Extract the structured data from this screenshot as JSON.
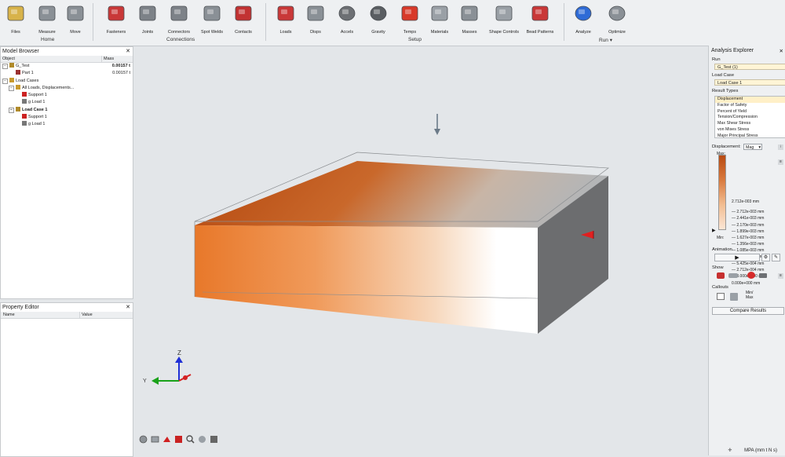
{
  "ribbon": {
    "tools": [
      {
        "label": "Files",
        "icon": "folder-icon"
      },
      {
        "label": "Measure",
        "icon": "measure-icon"
      },
      {
        "label": "Move",
        "icon": "move-icon"
      },
      {
        "label": "Fasteners",
        "icon": "fastener-icon"
      },
      {
        "label": "Joints",
        "icon": "joint-icon"
      },
      {
        "label": "Connectors",
        "icon": "connector-icon"
      },
      {
        "label": "Spot Welds",
        "icon": "spot-weld-icon"
      },
      {
        "label": "Contacts",
        "icon": "contact-icon"
      },
      {
        "label": "Loads",
        "icon": "load-icon"
      },
      {
        "label": "Disps",
        "icon": "displacement-icon"
      },
      {
        "label": "Accels",
        "icon": "acceleration-icon"
      },
      {
        "label": "Gravity",
        "icon": "gravity-icon"
      },
      {
        "label": "Temps",
        "icon": "temperature-icon"
      },
      {
        "label": "Materials",
        "icon": "material-icon"
      },
      {
        "label": "Masses",
        "icon": "mass-icon"
      },
      {
        "label": "Shape Controls",
        "icon": "shape-control-icon"
      },
      {
        "label": "Bead Patterns",
        "icon": "bead-pattern-icon"
      },
      {
        "label": "Analyze",
        "icon": "analyze-icon"
      },
      {
        "label": "Optimize",
        "icon": "optimize-icon"
      }
    ],
    "groups": {
      "home": "Home",
      "connections": "Connections",
      "setup": "Setup",
      "run": "Run"
    }
  },
  "model_browser": {
    "title": "Model Browser",
    "col_object": "Object",
    "col_mass": "Mass",
    "rows": [
      {
        "label": "G_Test",
        "mass": "0.00157 t"
      },
      {
        "label": "Part 1",
        "mass": "0.00157 t"
      },
      {
        "label": "Load Cases",
        "mass": ""
      },
      {
        "label": "All Loads, Displacements...",
        "mass": ""
      },
      {
        "label": "Support 1",
        "mass": ""
      },
      {
        "label": "g Load 1",
        "mass": ""
      },
      {
        "label": "Load Case 1",
        "mass": ""
      },
      {
        "label": "Support 1",
        "mass": ""
      },
      {
        "label": "g Load 1",
        "mass": ""
      }
    ]
  },
  "property_editor": {
    "title": "Property Editor",
    "col_name": "Name",
    "col_value": "Value"
  },
  "analysis_explorer": {
    "title": "Analysis Explorer",
    "run_label": "Run",
    "run_value": "G_Test (1)",
    "load_case_label": "Load Case",
    "load_case_value": "Load Case 1",
    "result_types_label": "Result Types",
    "result_types": [
      "Displacement",
      "Factor of Safety",
      "Percent of Yield",
      "Tension/Compression",
      "Max Shear Stress",
      "von Mises Stress",
      "Major Principal Stress"
    ],
    "selected_result": "Displacement",
    "displacement_label": "Displacement:",
    "component": "Mag",
    "max_label": "Max:",
    "min_label": "Min:",
    "legend": [
      "2.712e-003 mm",
      "2.712e-003 mm",
      "2.441e-003 mm",
      "2.170e-003 mm",
      "1.899e-003 mm",
      "1.627e-003 mm",
      "1.356e-003 mm",
      "1.085e-003 mm",
      "8.137e-004 mm",
      "5.425e-004 mm",
      "2.712e-004 mm",
      "0.000e+000 mm",
      "0.000e+000 mm"
    ],
    "animation_label": "Animation",
    "show_label": "Show",
    "callouts_label": "Callouts",
    "minmax_label_top": "Min/",
    "minmax_label_bottom": "Max",
    "compare_button": "Compare Results"
  },
  "status": {
    "units": "MPA (mm t N s)"
  },
  "triad": {
    "z": "Z",
    "y": "Y"
  },
  "colors": {
    "accent": "#d9641c",
    "ribbon": "#eef0f2",
    "viewport": "#e3e6e9",
    "selected": "#fff0c8"
  }
}
